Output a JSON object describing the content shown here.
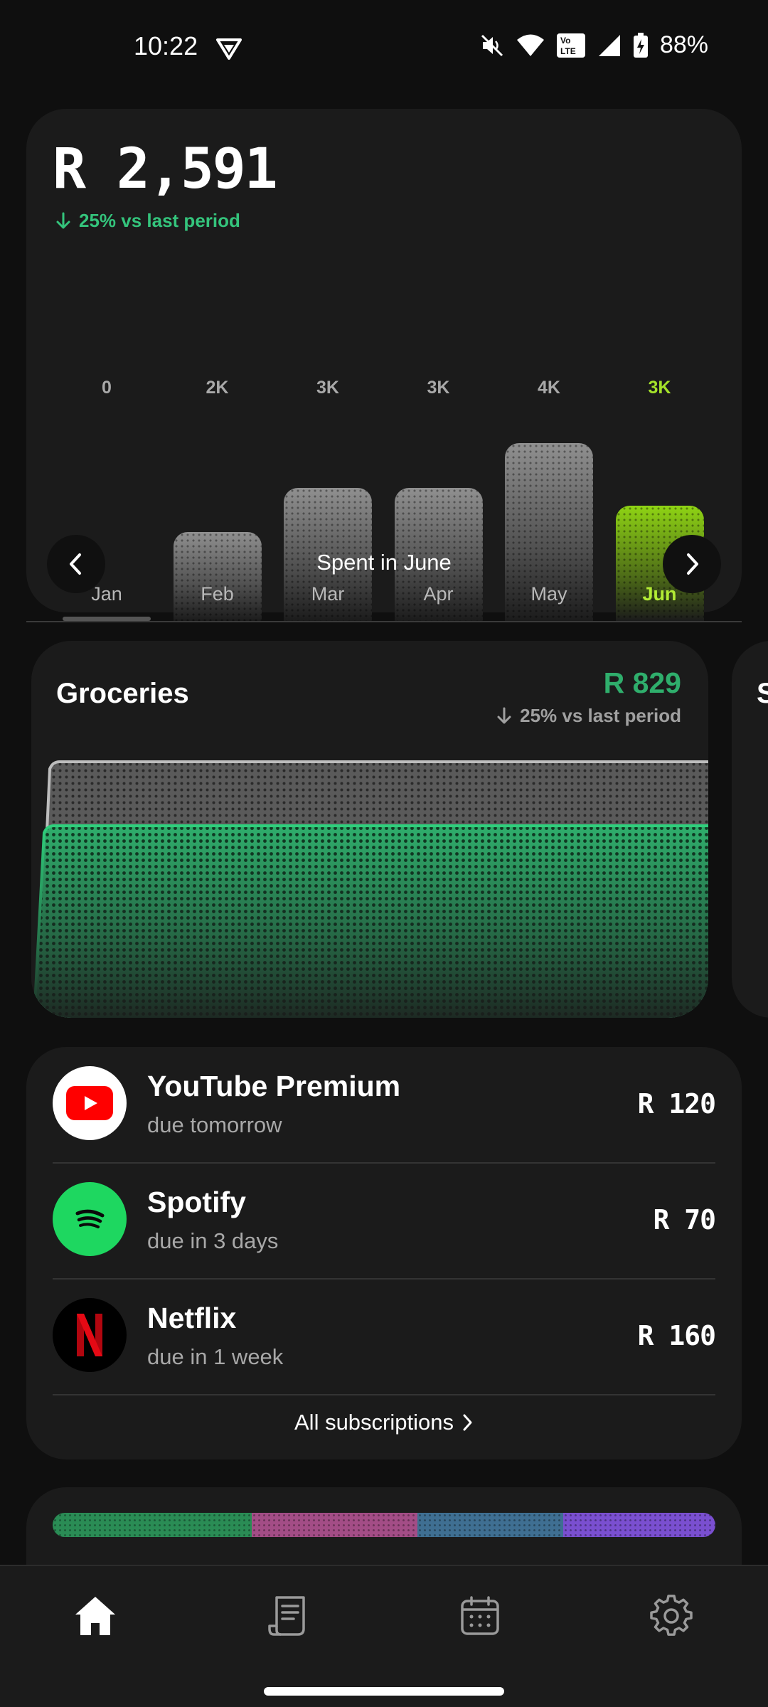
{
  "status_bar": {
    "time": "10:22",
    "battery_percent": "88%",
    "icons": [
      "vpn-icon",
      "mute-icon",
      "wifi-icon",
      "volte-icon",
      "signal-icon",
      "battery-charging-icon"
    ]
  },
  "spend_summary": {
    "total": "R 2,591",
    "change_text": "25% vs last period",
    "change_direction": "down",
    "period_label": "Spent in June",
    "accent_color": "#a4e22a",
    "chart_data": {
      "type": "bar",
      "categories": [
        "Jan",
        "Feb",
        "Mar",
        "Apr",
        "May",
        "Jun"
      ],
      "value_labels": [
        "0",
        "2K",
        "3K",
        "3K",
        "4K",
        "3K"
      ],
      "values": [
        0,
        2000,
        3000,
        3000,
        4000,
        2591
      ],
      "active_index": 5
    }
  },
  "category": {
    "title": "Groceries",
    "amount": "R 829",
    "change_text": "25% vs last period",
    "change_direction": "down",
    "accent_color": "#2fae6c",
    "next_card_peek": "S"
  },
  "subscriptions": {
    "items": [
      {
        "name": "YouTube Premium",
        "due": "due tomorrow",
        "price": "R 120",
        "icon": "youtube-icon"
      },
      {
        "name": "Spotify",
        "due": "due in 3 days",
        "price": "R 70",
        "icon": "spotify-icon"
      },
      {
        "name": "Netflix",
        "due": "due in 1 week",
        "price": "R 160",
        "icon": "netflix-icon"
      }
    ],
    "all_label": "All subscriptions"
  },
  "breakdown": {
    "segment_colors": [
      "#2a8c55",
      "#a34d86",
      "#3f6f92",
      "#7a4fd0"
    ],
    "segment_shares": [
      0.3,
      0.25,
      0.22,
      0.23
    ]
  },
  "bottom_nav": {
    "items": [
      {
        "icon": "home-icon",
        "active": true
      },
      {
        "icon": "receipt-icon",
        "active": false
      },
      {
        "icon": "calendar-icon",
        "active": false
      },
      {
        "icon": "gear-icon",
        "active": false
      }
    ]
  }
}
